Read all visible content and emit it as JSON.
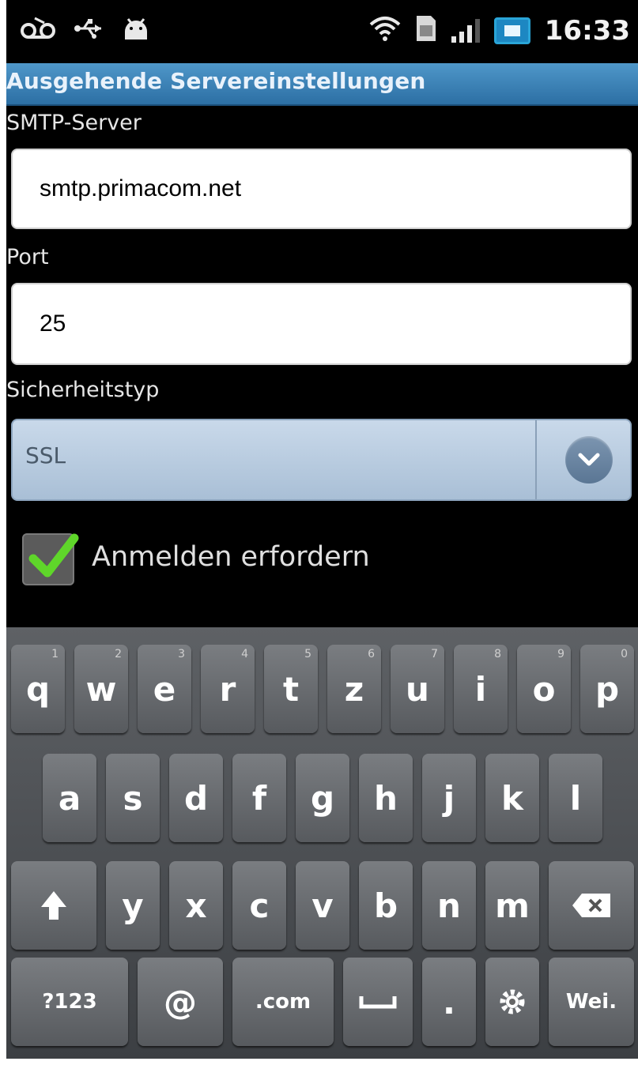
{
  "status_bar": {
    "time": "16:33",
    "left_icons": [
      "voicemail-icon",
      "usb-icon",
      "android-icon"
    ],
    "right_icons": [
      "wifi-icon",
      "sim-icon",
      "signal-icon",
      "battery-icon"
    ]
  },
  "title_bar": {
    "title": "Ausgehende Servereinstellungen"
  },
  "form": {
    "smtp_label": "SMTP-Server",
    "smtp_value": "smtp.primacom.net",
    "port_label": "Port",
    "port_value": "25",
    "security_label": "Sicherheitstyp",
    "security_value": "SSL",
    "auth_checkbox_label": "Anmelden erfordern",
    "auth_checked": true
  },
  "keyboard": {
    "row1": [
      {
        "key": "q",
        "num": "1"
      },
      {
        "key": "w",
        "num": "2"
      },
      {
        "key": "e",
        "num": "3"
      },
      {
        "key": "r",
        "num": "4"
      },
      {
        "key": "t",
        "num": "5"
      },
      {
        "key": "z",
        "num": "6"
      },
      {
        "key": "u",
        "num": "7"
      },
      {
        "key": "i",
        "num": "8"
      },
      {
        "key": "o",
        "num": "9"
      },
      {
        "key": "p",
        "num": "0"
      }
    ],
    "row2": [
      "a",
      "s",
      "d",
      "f",
      "g",
      "h",
      "j",
      "k",
      "l"
    ],
    "row3": [
      "y",
      "x",
      "c",
      "v",
      "b",
      "n",
      "m"
    ],
    "sym_key": "?123",
    "at_key": "@",
    "com_key": ".com",
    "period_key": ".",
    "enter_key": "Wei.",
    "colors": {
      "accent": "#2c6fa4",
      "check_green": "#5fd62a"
    }
  }
}
